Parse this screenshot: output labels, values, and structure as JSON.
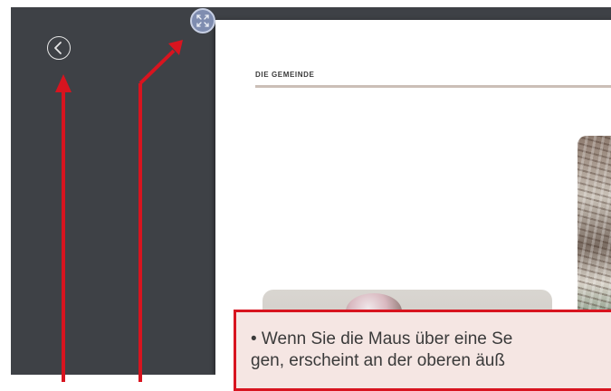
{
  "page": {
    "section_header": "DIE GEMEINDE"
  },
  "toolbar": {
    "back_icon": "chevron-left-circle-icon",
    "fullscreen_icon": "expand-arrows-icon"
  },
  "callout": {
    "line1": "• Wenn Sie die Maus über eine Se",
    "line2": "  gen, erscheint an der oberen äuß"
  },
  "colors": {
    "frame_bg": "#3e4146",
    "annotation_red": "#d8141f",
    "callout_bg": "#f5e6e3",
    "header_rule": "#cbbfb7"
  }
}
